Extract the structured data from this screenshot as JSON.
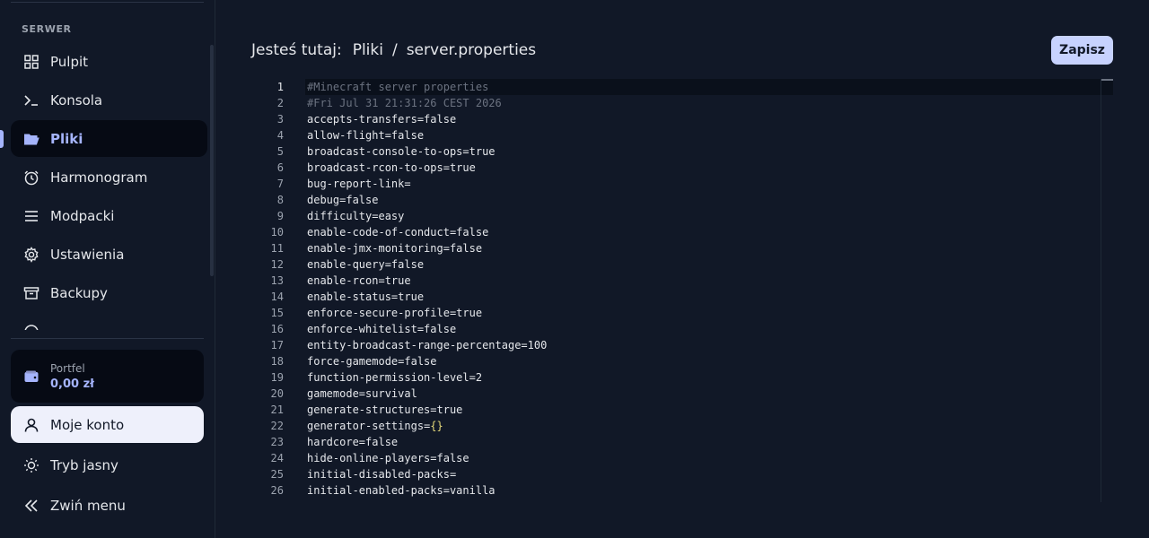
{
  "sidebar": {
    "section_title": "SERWER",
    "items": [
      {
        "label": "Pulpit",
        "icon": "grid-icon"
      },
      {
        "label": "Konsola",
        "icon": "terminal-icon"
      },
      {
        "label": "Pliki",
        "icon": "folder-open-icon",
        "active": true
      },
      {
        "label": "Harmonogram",
        "icon": "alarm-clock-icon"
      },
      {
        "label": "Modpacki",
        "icon": "list-icon"
      },
      {
        "label": "Ustawienia",
        "icon": "gear-icon"
      },
      {
        "label": "Backupy",
        "icon": "archive-icon"
      }
    ],
    "wallet": {
      "label": "Portfel",
      "value": "0,00 zł",
      "icon": "wallet-icon"
    },
    "account": {
      "label": "Moje konto",
      "icon": "user-icon"
    },
    "theme": {
      "label": "Tryb jasny",
      "icon": "sun-icon"
    },
    "collapse": {
      "label": "Zwiń menu",
      "icon": "double-chevron-left-icon"
    }
  },
  "breadcrumb": {
    "prefix": "Jesteś tutaj:",
    "items": [
      "Pliki",
      "server.properties"
    ],
    "separator": "/"
  },
  "toolbar": {
    "save_label": "Zapisz"
  },
  "editor": {
    "current_line": 1,
    "lines": [
      "#Minecraft server properties",
      "#Fri Jul 31 21:31:26 CEST 2026",
      "accepts-transfers=false",
      "allow-flight=false",
      "broadcast-console-to-ops=true",
      "broadcast-rcon-to-ops=true",
      "bug-report-link=",
      "debug=false",
      "difficulty=easy",
      "enable-code-of-conduct=false",
      "enable-jmx-monitoring=false",
      "enable-query=false",
      "enable-rcon=true",
      "enable-status=true",
      "enforce-secure-profile=true",
      "enforce-whitelist=false",
      "entity-broadcast-range-percentage=100",
      "force-gamemode=false",
      "function-permission-level=2",
      "gamemode=survival",
      "generate-structures=true",
      "generator-settings={}",
      "hardcore=false",
      "hide-online-players=false",
      "initial-disabled-packs=",
      "initial-enabled-packs=vanilla"
    ]
  },
  "colors": {
    "background": "#111827",
    "accent": "#a5b4fc",
    "button": "#c7d2fe"
  }
}
